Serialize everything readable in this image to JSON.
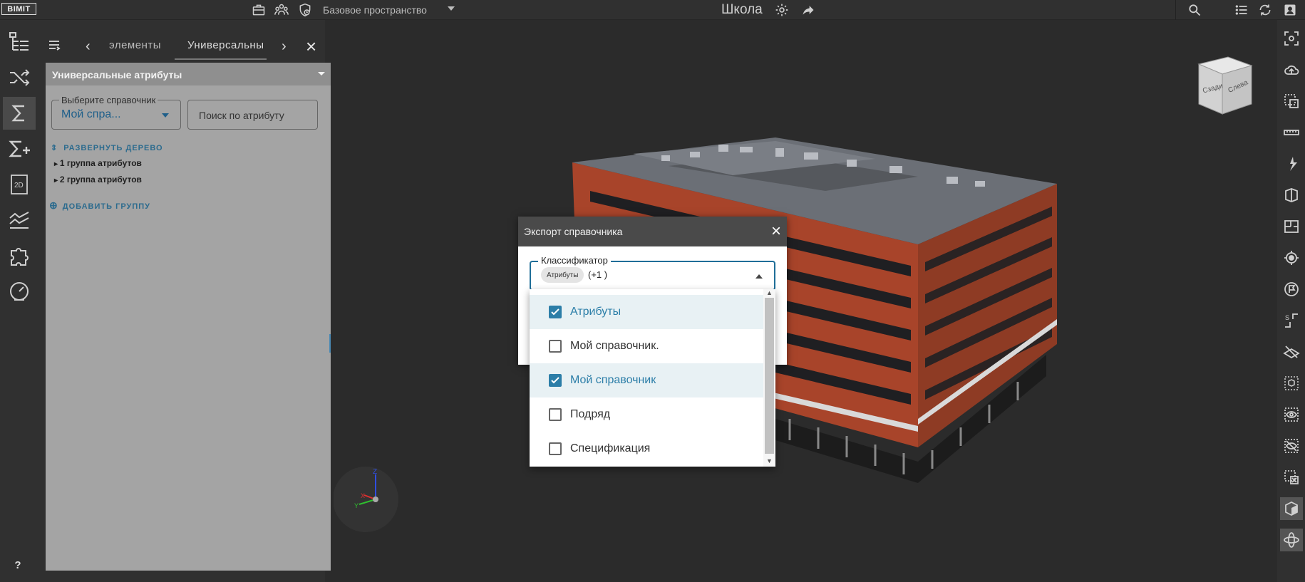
{
  "app": {
    "logo_text": "BIMIT",
    "space_name": "Базовое пространство",
    "project_title": "Школа"
  },
  "panel": {
    "tabs": [
      {
        "label": "элементы"
      },
      {
        "label": "Универсальны"
      }
    ],
    "section_title": "Универсальные атрибуты",
    "reference_field": {
      "label": "Выберите справочник",
      "value": "Мой спра..."
    },
    "search_placeholder": "Поиск по атрибуту",
    "expand_tree": "РАЗВЕРНУТЬ ДЕРЕВО",
    "groups": [
      "1 группа атрибутов",
      "2 группа атрибутов"
    ],
    "add_group": "ДОБАВИТЬ ГРУППУ"
  },
  "viewcube": {
    "front": "Сзади",
    "side": "Слева"
  },
  "axes": {
    "z": "Z",
    "x": "X",
    "y": "Y"
  },
  "dialog": {
    "title": "Экспорт справочника",
    "classifier_label": "Классификатор",
    "chip": "Атрибуты",
    "more": "(+1 )"
  },
  "dropdown": {
    "items": [
      {
        "label": "Атрибуты",
        "checked": true
      },
      {
        "label": "Мой справочник.",
        "checked": false
      },
      {
        "label": "Мой справочник",
        "checked": true
      },
      {
        "label": "Подряд",
        "checked": false
      },
      {
        "label": "Спецификация",
        "checked": false
      }
    ]
  },
  "help": "?",
  "colors": {
    "accent": "#2c7ea8",
    "panel_body": "#a4a4a4",
    "building_brick": "#b04a2a"
  }
}
